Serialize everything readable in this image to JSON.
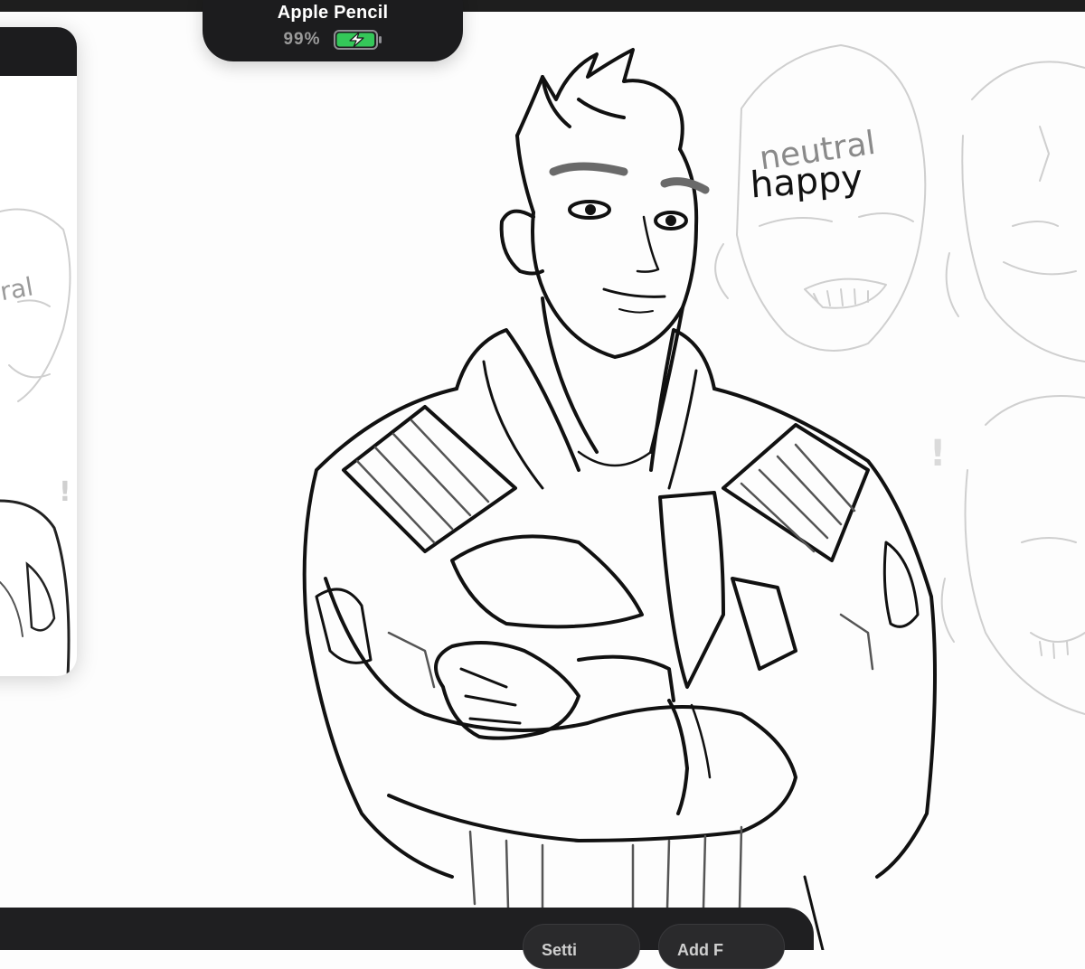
{
  "hud": {
    "device_name": "Apple Pencil",
    "battery_percent_label": "99%",
    "battery_level": 0.99,
    "charging": true,
    "battery_color": "#34c759"
  },
  "canvas": {
    "annotation_top": "neutral",
    "annotation_bottom": "happy",
    "exclamation": "!",
    "side_annotation": "ral",
    "side_exclamation": "!"
  },
  "bottom_bar": {
    "buttons": [
      {
        "label": "Setti",
        "icon": "none"
      },
      {
        "label": "Add F",
        "icon": "none"
      }
    ]
  },
  "colors": {
    "dark_ui": "#1c1c1e",
    "canvas": "#fdfdfd",
    "ink": "#111111",
    "sketch_gray": "#c9c9c9"
  }
}
